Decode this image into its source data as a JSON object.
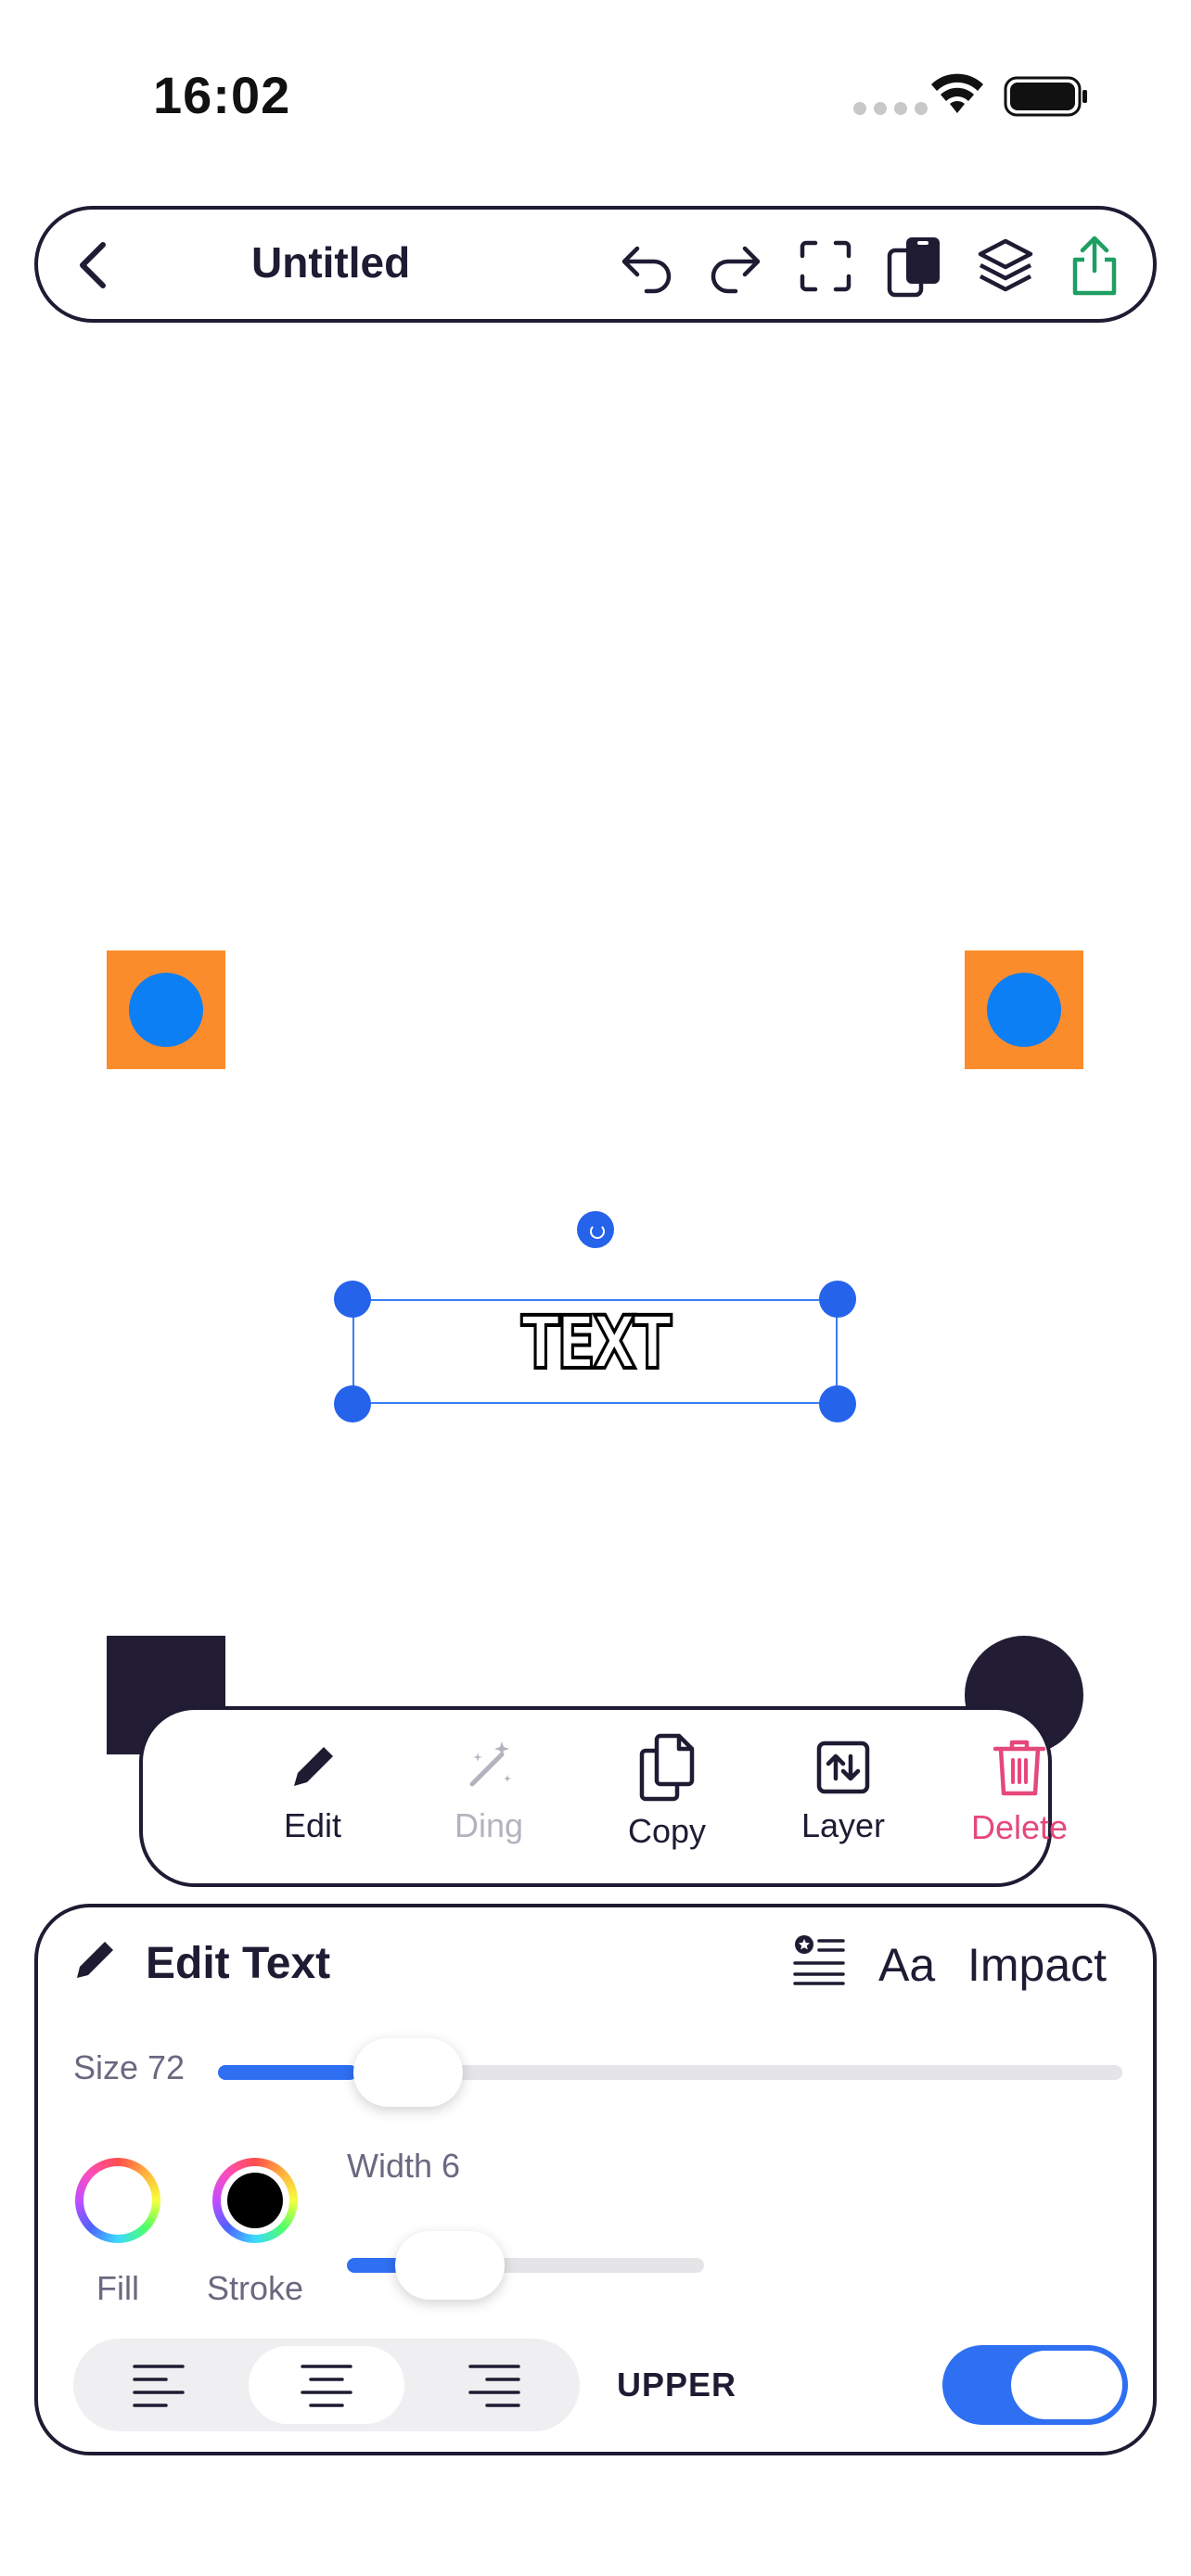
{
  "status_bar": {
    "time": "16:02"
  },
  "toolbar": {
    "title": "Untitled",
    "share_color": "#1e9e63"
  },
  "canvas": {
    "text_element": "TEXT",
    "colors": {
      "orange": "#fb8c2c",
      "blue": "#0d7ff4",
      "dark": "#221c35",
      "selection": "#2563eb"
    }
  },
  "context_menu": {
    "items": [
      {
        "label": "Edit",
        "icon": "pencil-icon",
        "state": "enabled"
      },
      {
        "label": "Ding",
        "icon": "magic-wand-icon",
        "state": "disabled"
      },
      {
        "label": "Copy",
        "icon": "copy-icon",
        "state": "enabled"
      },
      {
        "label": "Layer",
        "icon": "layer-swap-icon",
        "state": "enabled"
      },
      {
        "label": "Delete",
        "icon": "trash-icon",
        "state": "danger"
      }
    ],
    "danger_color": "#e5487a"
  },
  "edit_panel": {
    "title": "Edit Text",
    "aa_label": "Aa",
    "font_name": "Impact",
    "size_label": "Size 72",
    "size_value": 72,
    "fill_label": "Fill",
    "stroke_label": "Stroke",
    "width_label": "Width 6",
    "width_value": 6,
    "alignment": {
      "options": [
        "left",
        "center",
        "right"
      ],
      "selected": "center"
    },
    "upper_label": "UPPER",
    "upper_enabled": true,
    "accent_color": "#2f6ff2"
  }
}
